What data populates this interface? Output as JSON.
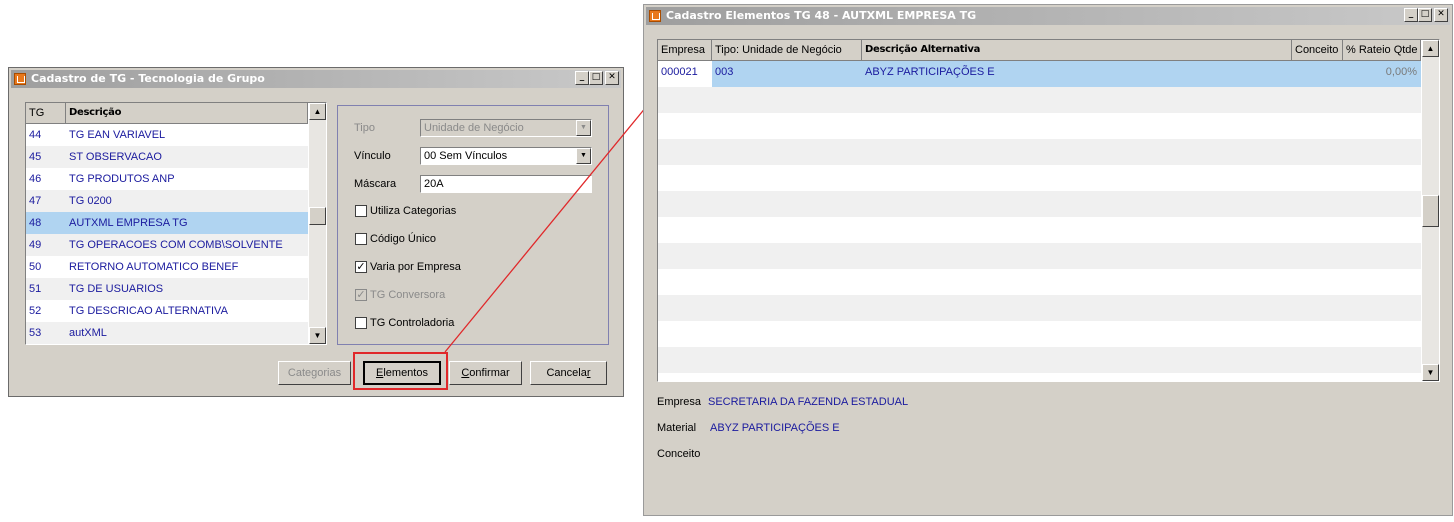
{
  "dialog1": {
    "title": "Cadastro de TG - Tecnologia de Grupo",
    "controls": {
      "minimize": "_",
      "maximize": "□",
      "close": "✕"
    },
    "grid": {
      "headers": [
        "TG",
        "Descrição"
      ],
      "rows": [
        {
          "tg": "44",
          "desc": "TG EAN VARIAVEL"
        },
        {
          "tg": "45",
          "desc": "ST OBSERVACAO"
        },
        {
          "tg": "46",
          "desc": "TG PRODUTOS ANP"
        },
        {
          "tg": "47",
          "desc": "TG 0200"
        },
        {
          "tg": "48",
          "desc": "AUTXML EMPRESA TG"
        },
        {
          "tg": "49",
          "desc": "TG OPERACOES COM COMB\\SOLVENTE"
        },
        {
          "tg": "50",
          "desc": "RETORNO AUTOMATICO BENEF"
        },
        {
          "tg": "51",
          "desc": "TG DE USUARIOS"
        },
        {
          "tg": "52",
          "desc": "TG DESCRICAO ALTERNATIVA"
        },
        {
          "tg": "53",
          "desc": "autXML"
        }
      ],
      "selected_index": 4
    },
    "form": {
      "tipo_label": "Tipo",
      "tipo_value": "Unidade de Negócio",
      "vinculo_label": "Vínculo",
      "vinculo_value": "00 Sem Vínculos",
      "mascara_label": "Máscara",
      "mascara_value": "20A",
      "utiliza_categorias": "Utiliza Categorias",
      "codigo_unico": "Código Único",
      "varia_por_empresa": "Varia por Empresa",
      "tg_conversora": "TG Conversora",
      "tg_controladoria": "TG Controladoria"
    },
    "buttons": {
      "categorias": "Categorias",
      "elementos_first": "E",
      "elementos_rest": "lementos",
      "confirmar_first": "C",
      "confirmar_rest": "onfirmar",
      "cancelar_main": "Cancela",
      "cancelar_last": "r"
    }
  },
  "dialog2": {
    "title": "Cadastro Elementos TG 48 - AUTXML EMPRESA TG",
    "controls": {
      "minimize": "_",
      "maximize": "□",
      "close": "✕"
    },
    "grid": {
      "headers": [
        "Empresa",
        "Tipo: Unidade de Negócio",
        "Descrição Alternativa",
        "Conceito",
        "% Rateio Qtde"
      ],
      "rows": [
        {
          "empresa": "000021",
          "tipo": "003",
          "descricao": "ABYZ PARTICIPAÇÕES E",
          "conceito": "",
          "rateio": "0,00%"
        }
      ]
    },
    "info": {
      "empresa_label": "Empresa",
      "empresa_value": "SECRETARIA DA FAZENDA ESTADUAL",
      "material_label": "Material",
      "material_value": "ABYZ PARTICIPAÇÕES E",
      "conceito_label": "Conceito"
    }
  },
  "colors": {
    "highlight_box": "#e0282a",
    "arrow": "#e0282a",
    "selected_row": "#b0d4f1",
    "value_text": "#1a1a9e"
  },
  "icons": [
    "app-icon",
    "scroll-up-icon",
    "scroll-down-icon",
    "dropdown-arrow-icon",
    "checkmark-icon"
  ]
}
